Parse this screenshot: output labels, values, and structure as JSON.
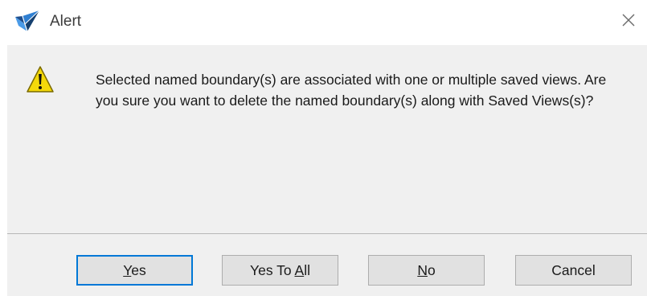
{
  "window": {
    "title": "Alert",
    "icon": "app-logo-icon",
    "close_icon": "close-icon"
  },
  "message": {
    "icon": "warning-icon",
    "text": "Selected named boundary(s) are associated with one or multiple saved views. Are you sure you want to delete the named boundary(s) along with Saved Views(s)?"
  },
  "buttons": {
    "yes": {
      "before": "",
      "mnemonic": "Y",
      "after": "es"
    },
    "yes_to_all": {
      "before": "Yes To ",
      "mnemonic": "A",
      "after": "ll"
    },
    "no": {
      "before": "",
      "mnemonic": "N",
      "after": "o"
    },
    "cancel": {
      "label": "Cancel"
    }
  },
  "colors": {
    "default_button_border": "#0078d7",
    "content_background": "#f0f0f0",
    "warning_fill": "#f5d90a"
  }
}
